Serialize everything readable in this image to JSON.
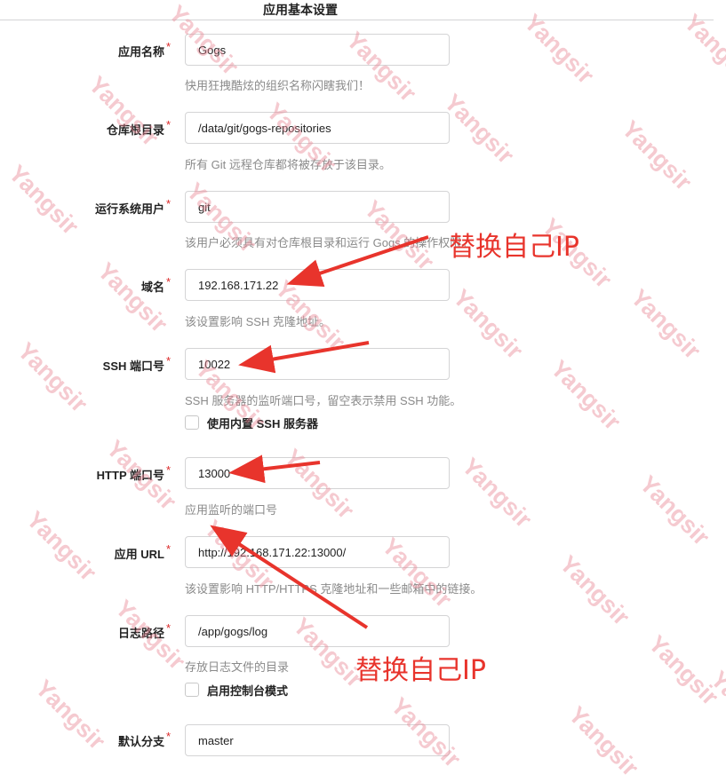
{
  "section_title": "应用基本设置",
  "required_mark": "*",
  "fields": {
    "app_name": {
      "label": "应用名称",
      "value": "Gogs",
      "help": "快用狂拽酷炫的组织名称闪瞎我们！"
    },
    "repo_root": {
      "label": "仓库根目录",
      "value": "/data/git/gogs-repositories",
      "help": "所有 Git 远程仓库都将被存放于该目录。"
    },
    "run_user": {
      "label": "运行系统用户",
      "value": "git",
      "help": "该用户必须具有对仓库根目录和运行 Gogs 的操作权限。"
    },
    "domain": {
      "label": "域名",
      "value": "192.168.171.22",
      "help": "该设置影响 SSH 克隆地址。"
    },
    "ssh_port": {
      "label": "SSH 端口号",
      "value": "10022",
      "help": "SSH 服务器的监听端口号，留空表示禁用 SSH 功能。"
    },
    "builtin_ssh": {
      "label": "使用内置 SSH 服务器",
      "checked": false
    },
    "http_port": {
      "label": "HTTP 端口号",
      "value": "13000",
      "help": "应用监听的端口号"
    },
    "app_url": {
      "label": "应用 URL",
      "value": "http://192.168.171.22:13000/",
      "help": "该设置影响 HTTP/HTTPS 克隆地址和一些邮箱中的链接。"
    },
    "log_path": {
      "label": "日志路径",
      "value": "/app/gogs/log",
      "help": "存放日志文件的目录"
    },
    "console_mode": {
      "label": "启用控制台模式",
      "checked": false
    },
    "default_branch": {
      "label": "默认分支",
      "value": "master"
    }
  },
  "annotations": {
    "note_top": "替换自己IP",
    "note_bottom": "替换自己IP",
    "arrow_color": "#e8342c"
  },
  "watermark": {
    "text": "Yangsir",
    "color": "#e88a96"
  }
}
